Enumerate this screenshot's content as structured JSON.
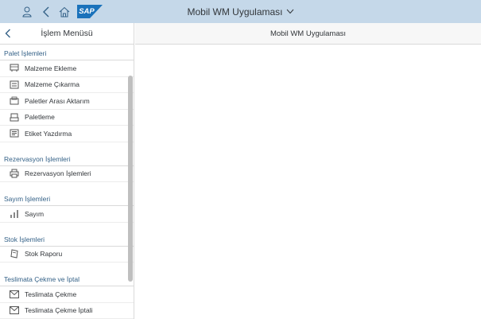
{
  "shell": {
    "title": "Mobil WM Uygulaması",
    "logo_text": "SAP",
    "colors": {
      "bar": "#c5d8e9",
      "logo": "#1a72bb"
    }
  },
  "sidebar": {
    "title": "İşlem Menüsü",
    "sections": [
      {
        "title": "Palet İşlemleri",
        "items": [
          {
            "label": "Malzeme Ekleme",
            "icon": "pallet-add-icon"
          },
          {
            "label": "Malzeme Çıkarma",
            "icon": "pallet-remove-icon"
          },
          {
            "label": "Paletler Arası Aktarım",
            "icon": "transfer-icon"
          },
          {
            "label": "Paletleme",
            "icon": "palletize-icon"
          },
          {
            "label": "Etiket Yazdırma",
            "icon": "label-print-icon"
          }
        ]
      },
      {
        "title": "Rezervasyon İşlemleri",
        "items": [
          {
            "label": "Rezervasyon İşlemleri",
            "icon": "printer-icon"
          }
        ]
      },
      {
        "title": "Sayım İşlemleri",
        "items": [
          {
            "label": "Sayım",
            "icon": "bar-chart-icon"
          }
        ]
      },
      {
        "title": "Stok İşlemleri",
        "items": [
          {
            "label": "Stok Raporu",
            "icon": "stock-report-icon"
          }
        ]
      },
      {
        "title": "Teslimata Çekme ve İptal",
        "items": [
          {
            "label": "Teslimata Çekme",
            "icon": "envelope-icon"
          },
          {
            "label": "Teslimata Çekme İptali",
            "icon": "envelope-icon"
          }
        ]
      }
    ]
  },
  "main": {
    "title": "Mobil WM Uygulaması"
  }
}
